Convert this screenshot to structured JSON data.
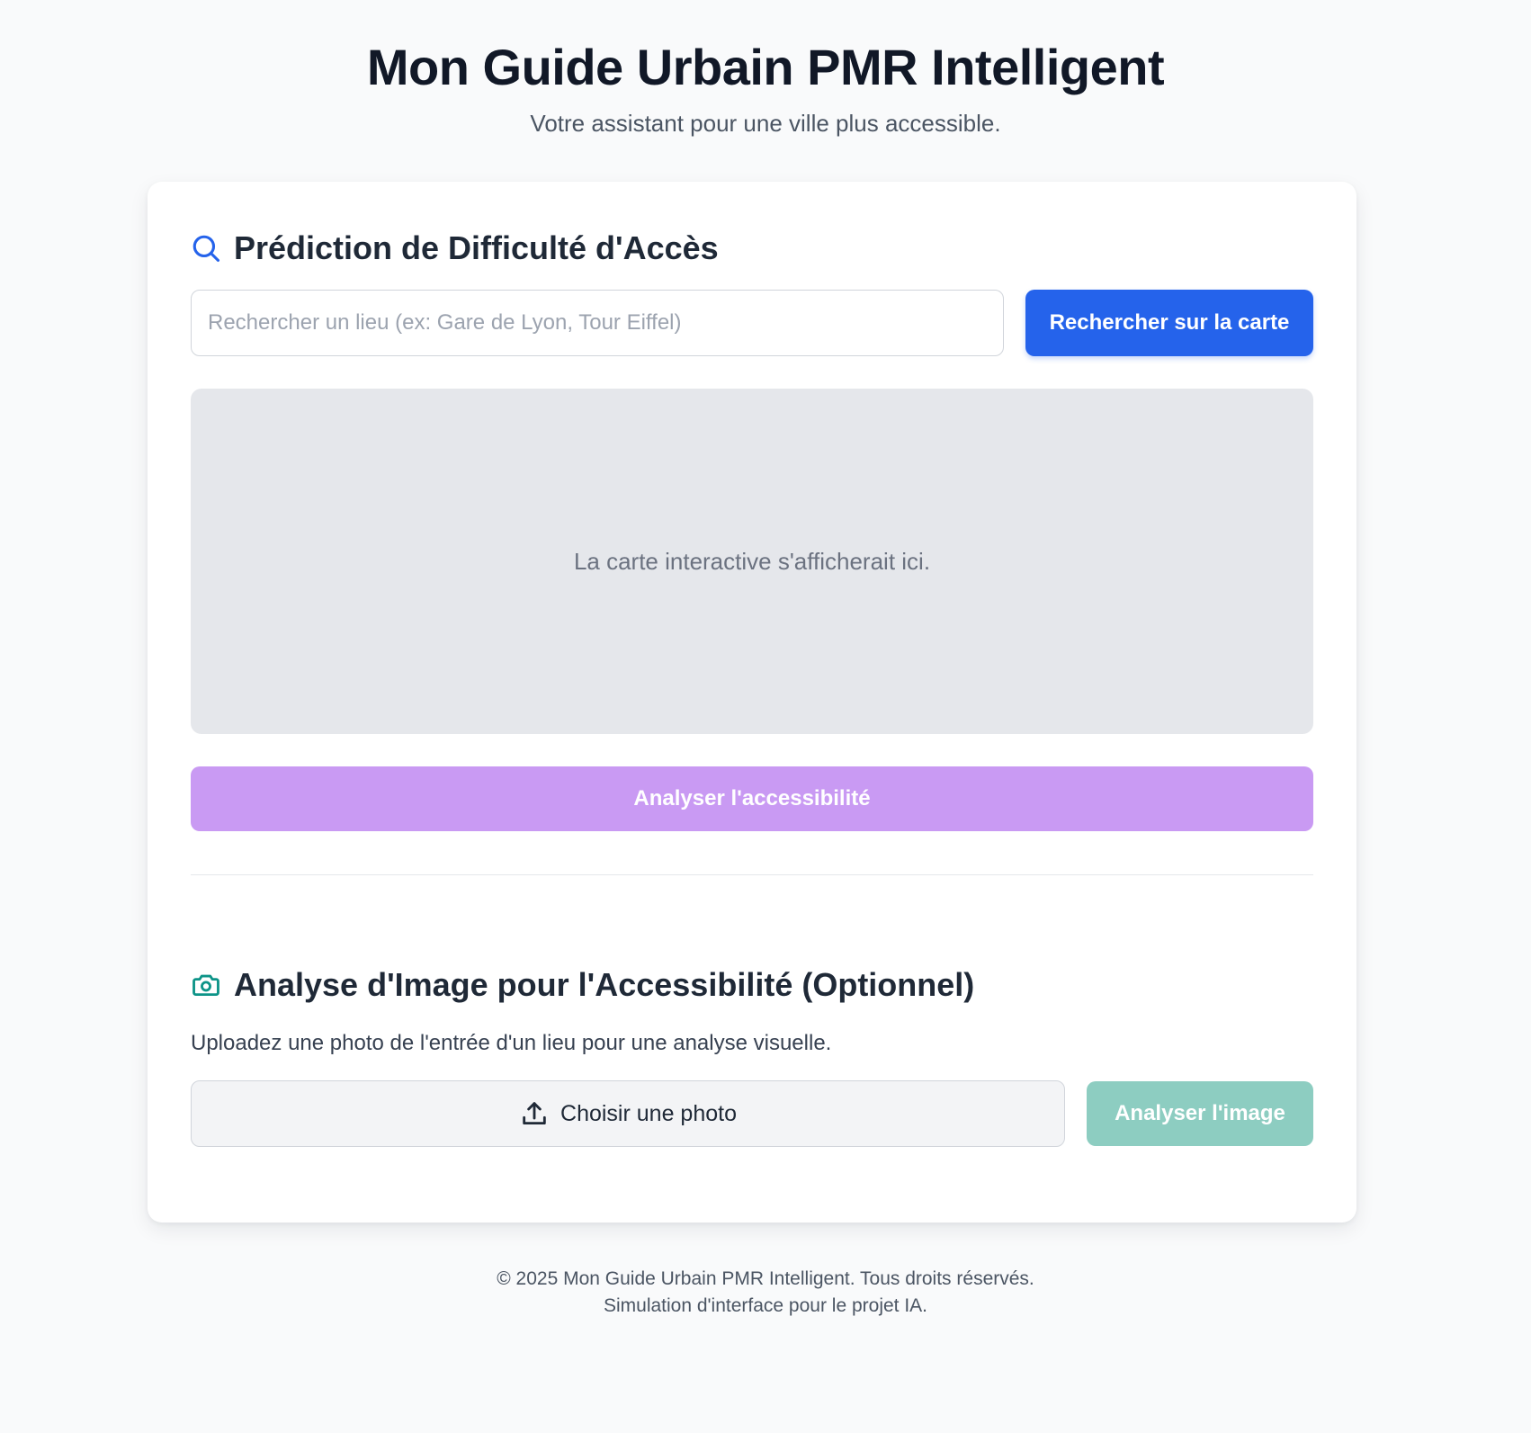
{
  "header": {
    "title": "Mon Guide Urbain PMR Intelligent",
    "subtitle": "Votre assistant pour une ville plus accessible."
  },
  "prediction": {
    "icon": "search-icon",
    "heading": "Prédiction de Difficulté d'Accès",
    "search_placeholder": "Rechercher un lieu (ex: Gare de Lyon, Tour Eiffel)",
    "search_value": "",
    "search_button": "Rechercher sur la carte",
    "map_placeholder": "La carte interactive s'afficherait ici.",
    "analyze_button": "Analyser l'accessibilité"
  },
  "image_analysis": {
    "icon": "camera-icon",
    "heading": "Analyse d'Image pour l'Accessibilité (Optionnel)",
    "description": "Uploadez une photo de l'entrée d'un lieu pour une analyse visuelle.",
    "upload_icon": "upload-icon",
    "choose_photo": "Choisir une photo",
    "analyze_button": "Analyser l'image"
  },
  "footer": {
    "copyright": "© 2025 Mon Guide Urbain PMR Intelligent. Tous droits réservés.",
    "note": "Simulation d'interface pour le projet IA."
  },
  "colors": {
    "accent_blue": "#2563eb",
    "analyze_purple": "#c99af3",
    "analyze_teal": "#8dcdc1",
    "camera_teal": "#0d9488",
    "page_background": "#f9fafb"
  }
}
